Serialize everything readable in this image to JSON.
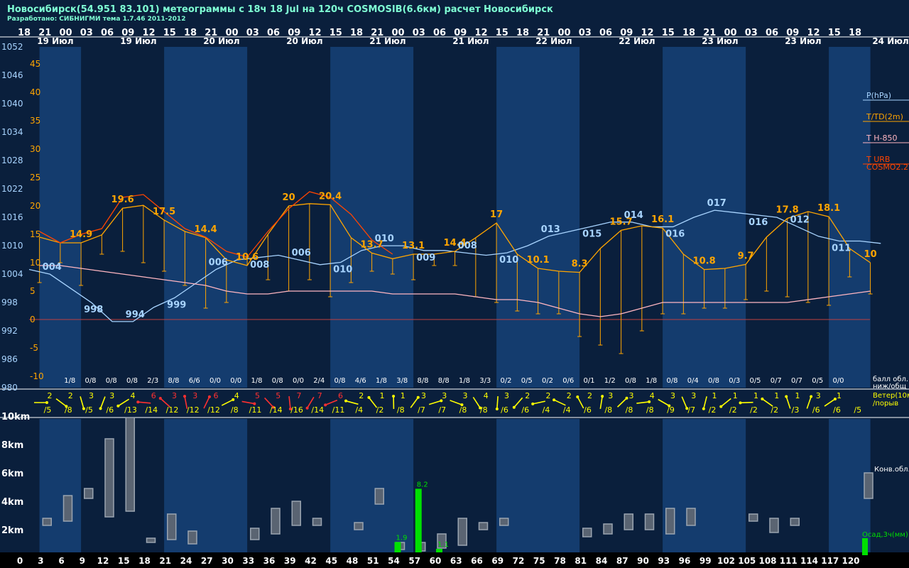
{
  "header": {
    "title": "Новосибирск(54.951 83.101) метеограммы с  18ч 18 Jul на 120ч COSMOSIB(6.6км) расчет Новосибирск",
    "subtitle": "Разработано: СИБНИГМИ тема 1.7.46 2011-2012"
  },
  "colors": {
    "background": "#0a1f3c",
    "band_dark": "#0a1f3c",
    "band_light": "#143c6e",
    "pressure": "#a8d4ff",
    "temperature": "#ffa500",
    "h850": "#ffb6c1",
    "urb": "#ff4500",
    "wind_normal": "#ffff00",
    "wind_strong": "#ff3030",
    "precip": "#00e000",
    "cloud": "#9aa4b0",
    "zero_line": "#c04040"
  },
  "time_axis": {
    "hours_top": [
      "18",
      "21",
      "00",
      "03",
      "06",
      "09",
      "12",
      "15",
      "18",
      "21",
      "00",
      "03",
      "06",
      "09",
      "12",
      "15",
      "18",
      "21",
      "00",
      "03",
      "06",
      "09",
      "12",
      "15",
      "18",
      "21",
      "00",
      "03",
      "06",
      "09",
      "12",
      "15",
      "18",
      "21",
      "00",
      "03",
      "06",
      "09",
      "12",
      "15",
      "18"
    ],
    "lead_hours": [
      "0",
      "3",
      "6",
      "9",
      "12",
      "15",
      "18",
      "21",
      "24",
      "27",
      "30",
      "33",
      "36",
      "39",
      "42",
      "45",
      "48",
      "51",
      "54",
      "57",
      "60",
      "63",
      "66",
      "69",
      "72",
      "75",
      "78",
      "81",
      "84",
      "87",
      "90",
      "93",
      "96",
      "99",
      "102",
      "105",
      "108",
      "111",
      "114",
      "117",
      "120"
    ],
    "day_labels": [
      {
        "label": "19 Июл",
        "at": 1.5
      },
      {
        "label": "19 Июл",
        "at": 5.5
      },
      {
        "label": "20 Июл",
        "at": 9.5
      },
      {
        "label": "20 Июл",
        "at": 13.5
      },
      {
        "label": "21 Июл",
        "at": 17.5
      },
      {
        "label": "21 Июл",
        "at": 21.5
      },
      {
        "label": "22 Июл",
        "at": 25.5
      },
      {
        "label": "22 Июл",
        "at": 29.5
      },
      {
        "label": "23 Июл",
        "at": 33.5
      },
      {
        "label": "23 Июл",
        "at": 37.5
      }
    ],
    "right_day_label": "24 Июл",
    "night_bands": [
      [
        0,
        2
      ],
      [
        6,
        10
      ],
      [
        14,
        18
      ],
      [
        22,
        26
      ],
      [
        30,
        34
      ],
      [
        38,
        40
      ]
    ]
  },
  "legend": {
    "pressure": "P(hPa)",
    "temperature": "T/TD(2m)",
    "h850": "T H-850",
    "urb_1": "T URB",
    "urb_2": "COSMO2.2",
    "clouds_1": "балл обл.",
    "clouds_2": "ниж/общ",
    "wind_1": "Ветер(10м)",
    "wind_2": "/порыв",
    "conv_clouds": "Конв.обл.",
    "precip": "Осад,3ч(мм)"
  },
  "chart_data": [
    {
      "type": "line",
      "title": "",
      "x_unit": "lead hours",
      "y_left": {
        "name": "pressure",
        "unit": "hPa",
        "lim": [
          980,
          1052
        ],
        "ticks": [
          980,
          986,
          992,
          998,
          1004,
          1010,
          1016,
          1022,
          1028,
          1034,
          1040,
          1046,
          1052
        ]
      },
      "y_temp": {
        "unit": "°C",
        "lim": [
          -10,
          45
        ],
        "ticks": [
          -10,
          -5,
          0,
          5,
          10,
          15,
          20,
          25,
          30,
          35,
          40,
          45
        ]
      },
      "series": [
        {
          "name": "P(hPa)",
          "color": "#a8d4ff",
          "values": [
            1005,
            1004,
            1001,
            998,
            994,
            994,
            997,
            999,
            1002,
            1005,
            1007,
            1007.5,
            1008,
            1007,
            1006,
            1006.5,
            1009,
            1010,
            1010,
            1009,
            1009,
            1008.5,
            1008,
            1008.5,
            1010,
            1012,
            1013,
            1014,
            1015,
            1015,
            1014,
            1014,
            1016,
            1017.5,
            1017,
            1016.5,
            1016,
            1014,
            1012,
            1011,
            1011,
            1010.5
          ]
        },
        {
          "name": "T/TD(2m)",
          "color": "#ffa500",
          "values": [
            14.5,
            13.5,
            13.5,
            14.9,
            19.6,
            20.1,
            17.5,
            15.5,
            14.4,
            10.5,
            9.5,
            15,
            20,
            20.4,
            20.2,
            14.4,
            11.7,
            10.7,
            11.5,
            11.5,
            12,
            14.4,
            17,
            11.5,
            9,
            8.5,
            8.3,
            12.5,
            15.7,
            16.5,
            16.1,
            11.5,
            8.8,
            9,
            9.7,
            14.5,
            17.8,
            19,
            18.1,
            12.5,
            10
          ]
        },
        {
          "name": "T H-850",
          "color": "#ffb6c1",
          "values": [
            9.5,
            9.5,
            9,
            8.5,
            8,
            7.5,
            7,
            6.5,
            6,
            5,
            4.5,
            4.5,
            5,
            5,
            5,
            5,
            5,
            4.5,
            4.5,
            4.5,
            4.5,
            4,
            3.5,
            3.5,
            3,
            2,
            1,
            0.5,
            1,
            2,
            3,
            3,
            3,
            3,
            3,
            3,
            3,
            3.5,
            4,
            4.5,
            5
          ]
        },
        {
          "name": "T URB",
          "color": "#ff4500",
          "values": [
            15.5,
            13.5,
            15,
            16,
            21.5,
            22,
            19,
            16,
            14.5,
            12,
            11,
            15.5,
            19.5,
            22.5,
            21.5,
            18.5,
            14,
            11.5
          ]
        }
      ],
      "temperature_labels": [
        {
          "i": 2,
          "text": "14.9"
        },
        {
          "i": 4,
          "text": "19.6"
        },
        {
          "i": 6,
          "text": "17.5"
        },
        {
          "i": 8,
          "text": "14.4"
        },
        {
          "i": 10,
          "text": "10.6"
        },
        {
          "i": 12,
          "text": "20"
        },
        {
          "i": 14,
          "text": "20.4"
        },
        {
          "i": 16,
          "text": "13.7"
        },
        {
          "i": 18,
          "text": "13.1"
        },
        {
          "i": 20,
          "text": "14.4"
        },
        {
          "i": 22,
          "text": "17"
        },
        {
          "i": 24,
          "text": "10.1"
        },
        {
          "i": 26,
          "text": "8.3"
        },
        {
          "i": 28,
          "text": "15.7"
        },
        {
          "i": 30,
          "text": "16.1"
        },
        {
          "i": 32,
          "text": "10.8"
        },
        {
          "i": 34,
          "text": "9.7"
        },
        {
          "i": 36,
          "text": "17.8"
        },
        {
          "i": 38,
          "text": "18.1"
        },
        {
          "i": 40,
          "text": "10"
        }
      ],
      "pressure_labels": [
        {
          "i": 1,
          "text": "004"
        },
        {
          "i": 3,
          "text": "998"
        },
        {
          "i": 5,
          "text": "994"
        },
        {
          "i": 7,
          "text": "999"
        },
        {
          "i": 9,
          "text": "006"
        },
        {
          "i": 11,
          "text": "008"
        },
        {
          "i": 13,
          "text": "006"
        },
        {
          "i": 15,
          "text": "010"
        },
        {
          "i": 17,
          "text": "010"
        },
        {
          "i": 19,
          "text": "009"
        },
        {
          "i": 21,
          "text": "008"
        },
        {
          "i": 23,
          "text": "010"
        },
        {
          "i": 25,
          "text": "013"
        },
        {
          "i": 27,
          "text": "015"
        },
        {
          "i": 29,
          "text": "014"
        },
        {
          "i": 31,
          "text": "016"
        },
        {
          "i": 33,
          "text": "017"
        },
        {
          "i": 35,
          "text": "016"
        },
        {
          "i": 37,
          "text": "012"
        },
        {
          "i": 39,
          "text": "011"
        }
      ],
      "dew_point": [
        6.5,
        10,
        6,
        11.5,
        12,
        10,
        8.5,
        6,
        2,
        3,
        11,
        7,
        5,
        7,
        4,
        6.5,
        8.5,
        8,
        7,
        9.5,
        9.5,
        4,
        3,
        1.5,
        1,
        1,
        -3,
        -4.5,
        -6,
        -2,
        1,
        1,
        2,
        2,
        3.5,
        5,
        4,
        3,
        2.5,
        7.5,
        4.5
      ]
    },
    {
      "type": "table",
      "name": "балл обл. ниж/общ",
      "cloud_cover": [
        "1/8",
        "0/8",
        "0/8",
        "0/8",
        "2/3",
        "8/8",
        "6/6",
        "0/0",
        "0/0",
        "1/8",
        "0/8",
        "0/0",
        "2/4",
        "0/8",
        "4/6",
        "1/8",
        "3/8",
        "8/8",
        "8/8",
        "1/8",
        "3/3",
        "0/2",
        "0/5",
        "0/2",
        "0/6",
        "0/1",
        "1/2",
        "0/8",
        "1/8",
        "0/8",
        "0/4",
        "0/8",
        "0/3",
        "0/5",
        "0/7",
        "0/7",
        "0/5",
        "0/0"
      ]
    },
    {
      "type": "table",
      "name": "Ветер(10м)/порыв",
      "wind_speed": [
        "2",
        "2",
        "3",
        "3",
        "4",
        "6",
        "3",
        "3",
        "6",
        "4",
        "5",
        "5",
        "7",
        "7",
        "6",
        "2",
        "1",
        "1",
        "3",
        "3",
        "3",
        "4",
        "3",
        "2",
        "2",
        "2",
        "2",
        "3",
        "3",
        "4",
        "3",
        "3",
        "1",
        "1",
        "1",
        "1",
        "1",
        "3",
        "1"
      ],
      "wind_gust": [
        "/5",
        "/8",
        "/5",
        "/6",
        "/13",
        "/14",
        "/12",
        "/12",
        "/12",
        "/8",
        "/11",
        "/14",
        "/16",
        "/14",
        "/11",
        "/4",
        "/2",
        "/8",
        "/7",
        "/7",
        "/8",
        "/8",
        "/6",
        "/6",
        "/4",
        "/4",
        "/6",
        "/8",
        "/8",
        "/8",
        "/9",
        "/7",
        "/2",
        "/2",
        "/2",
        "/2",
        "/3",
        "/6",
        "/6",
        "/5"
      ],
      "wind_strong": [
        5,
        6,
        7,
        8,
        10,
        11,
        12,
        13,
        14
      ]
    },
    {
      "type": "bar",
      "name": "Конв.обл.",
      "y_unit": "km",
      "ylim": [
        0,
        11
      ],
      "y_ticks": [
        {
          "v": 2,
          "t": "2km"
        },
        {
          "v": 4,
          "t": "4km"
        },
        {
          "v": 6,
          "t": "6km"
        },
        {
          "v": 8,
          "t": "8km"
        },
        {
          "v": 10,
          "t": "10km"
        }
      ],
      "y_zero_label": "0",
      "cloud_columns": [
        {
          "h": 3,
          "base": 2.3,
          "top": 2.8
        },
        {
          "h": 6,
          "base": 2.6,
          "top": 4.4
        },
        {
          "h": 9,
          "base": 4.2,
          "top": 4.9
        },
        {
          "h": 12,
          "base": 2.9,
          "top": 8.4
        },
        {
          "h": 15,
          "base": 3.3,
          "top": 9.9
        },
        {
          "h": 18,
          "base": 1.1,
          "top": 1.4
        },
        {
          "h": 21,
          "base": 1.3,
          "top": 3.1
        },
        {
          "h": 24,
          "base": 1.0,
          "top": 1.9
        },
        {
          "h": 33,
          "base": 1.3,
          "top": 2.1
        },
        {
          "h": 36,
          "base": 1.7,
          "top": 3.5
        },
        {
          "h": 39,
          "base": 2.3,
          "top": 4.0
        },
        {
          "h": 42,
          "base": 2.3,
          "top": 2.8
        },
        {
          "h": 48,
          "base": 2.0,
          "top": 2.5
        },
        {
          "h": 51,
          "base": 3.8,
          "top": 4.9
        },
        {
          "h": 54,
          "base": 0.6,
          "top": 1.1
        },
        {
          "h": 57,
          "base": 0.5,
          "top": 1.1
        },
        {
          "h": 60,
          "base": 0.7,
          "top": 1.7
        },
        {
          "h": 63,
          "base": 0.9,
          "top": 2.8
        },
        {
          "h": 66,
          "base": 2.0,
          "top": 2.5
        },
        {
          "h": 69,
          "base": 2.3,
          "top": 2.8
        },
        {
          "h": 81,
          "base": 1.5,
          "top": 2.1
        },
        {
          "h": 84,
          "base": 1.7,
          "top": 2.4
        },
        {
          "h": 87,
          "base": 2.0,
          "top": 3.1
        },
        {
          "h": 90,
          "base": 2.0,
          "top": 3.1
        },
        {
          "h": 93,
          "base": 1.7,
          "top": 3.5
        },
        {
          "h": 96,
          "base": 2.3,
          "top": 3.5
        },
        {
          "h": 105,
          "base": 2.6,
          "top": 3.1
        },
        {
          "h": 108,
          "base": 1.8,
          "top": 2.8
        },
        {
          "h": 111,
          "base": 2.3,
          "top": 2.8
        }
      ],
      "precip_3h": [
        {
          "h": 54,
          "mm": 1.9,
          "label": "1.9"
        },
        {
          "h": 57,
          "mm": 8.2,
          "label": "8.2"
        },
        {
          "h": 60,
          "mm": 1.1,
          "label": "1.1"
        }
      ],
      "precip_scale_mm_per_km": 1.68
    }
  ]
}
